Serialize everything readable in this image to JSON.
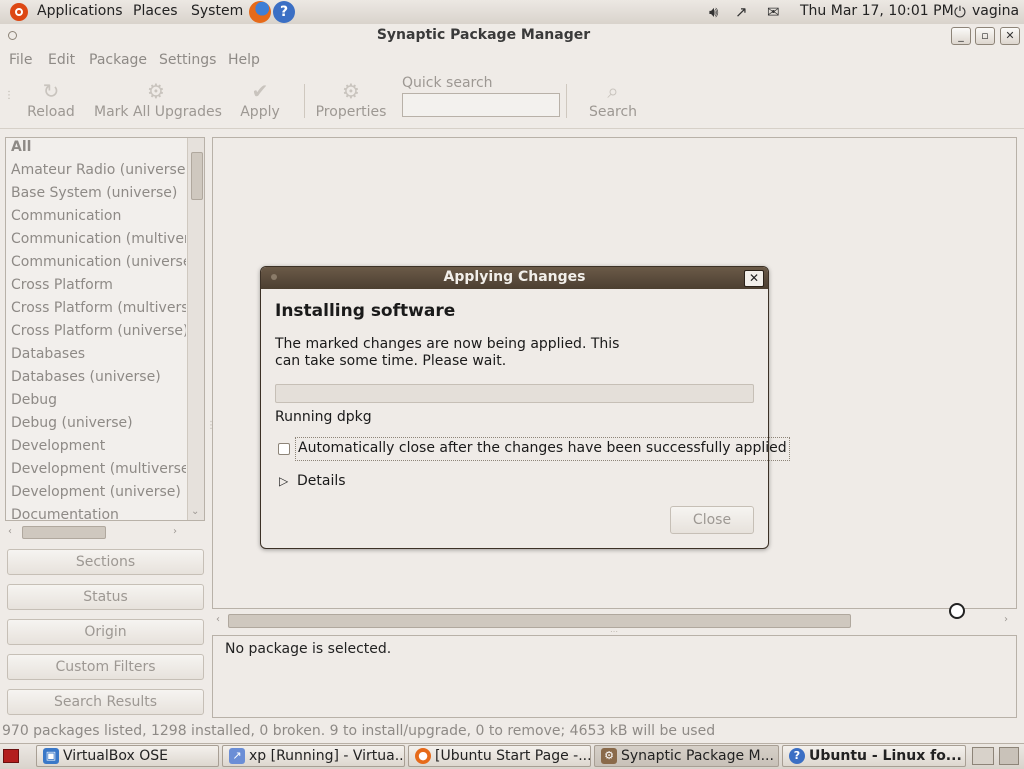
{
  "top_panel": {
    "menus": [
      "Applications",
      "Places",
      "System"
    ],
    "clock": "Thu Mar 17, 10:01 PM",
    "user": "vagina",
    "icons": [
      "ubuntu-logo-icon",
      "firefox-icon",
      "help-icon",
      "volume-icon",
      "network-icon",
      "mail-icon",
      "power-icon"
    ]
  },
  "window": {
    "title": "Synaptic Package Manager",
    "controls": [
      "_",
      "▫",
      "✕"
    ]
  },
  "menubar": [
    "File",
    "Edit",
    "Package",
    "Settings",
    "Help"
  ],
  "toolbar": {
    "reload": "Reload",
    "mark_all_upgrades": "Mark All Upgrades",
    "apply": "Apply",
    "properties": "Properties",
    "quick_search_label": "Quick search",
    "quick_search_value": "",
    "search": "Search"
  },
  "sections": [
    "All",
    "Amateur Radio (universe)",
    "Base System (universe)",
    "Communication",
    "Communication (multiverse)",
    "Communication (universe)",
    "Cross Platform",
    "Cross Platform (multiverse)",
    "Cross Platform (universe)",
    "Databases",
    "Databases (universe)",
    "Debug",
    "Debug (universe)",
    "Development",
    "Development (multiverse)",
    "Development (universe)",
    "Documentation"
  ],
  "filter_buttons": {
    "sections": "Sections",
    "status": "Status",
    "origin": "Origin",
    "custom_filters": "Custom Filters",
    "search_results": "Search Results"
  },
  "description": "No package is selected.",
  "status": "970 packages listed, 1298 installed, 0 broken. 9 to install/upgrade, 0 to remove; 4653 kB will be used",
  "dialog": {
    "title": "Applying Changes",
    "close_x": "✕",
    "heading": "Installing software",
    "message": "The marked changes are now being applied. This can take some time. Please wait.",
    "progress": 0,
    "progress_label": "Running dpkg",
    "auto_close_label": "Automatically close after the changes have been successfully applied",
    "auto_close_checked": false,
    "details_label": "Details",
    "close_button": "Close"
  },
  "taskbar": {
    "items": [
      "VirtualBox OSE",
      "xp [Running] - Virtua...",
      "[Ubuntu Start Page -...",
      "Synaptic Package M...",
      "Ubuntu - Linux fo..."
    ]
  }
}
